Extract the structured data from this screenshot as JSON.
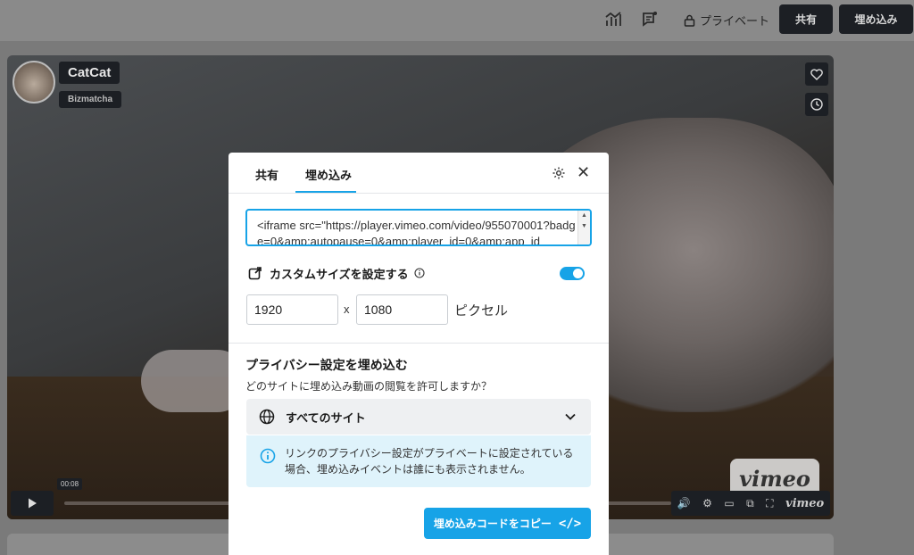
{
  "topbar": {
    "analytics_icon": "bar-chart-icon",
    "comments_icon": "comment-icon",
    "privacy_label": "プライベート",
    "share_label": "共有",
    "embed_label": "埋め込み"
  },
  "player": {
    "title": "CatCat",
    "author": "Bizmatcha",
    "time_tooltip": "00:08",
    "vimeo_logo": "vimeo",
    "ctrl_vimeo": "vimeo"
  },
  "modal": {
    "tabs": [
      {
        "label": "共有"
      },
      {
        "label": "埋め込み"
      }
    ],
    "active_tab": "埋め込み",
    "embed_code": "<iframe src=\"https://player.vimeo.com/video/955070001?badge=0&amp;autopause=0&amp;player_id=0&amp;app_id",
    "custom_size_label": "カスタムサイズを設定する",
    "custom_size_enabled": true,
    "width_value": "1920",
    "height_value": "1080",
    "times": "x",
    "pixel_label": "ピクセル",
    "privacy_title": "プライバシー設定を埋め込む",
    "privacy_question": "どのサイトに埋め込み動画の閲覧を許可しますか？",
    "privacy_option": "すべてのサイト",
    "notice_text": "リンクのプライバシー設定がプライベートに設定されている場合、埋め込みイベントは誰にも表示されません。",
    "copy_button": "埋め込みコードをコピー",
    "copy_icon": "</>"
  },
  "colors": {
    "accent": "#17a3e7",
    "dark_button": "#1c1f24",
    "notice_bg": "#dff3fb"
  }
}
